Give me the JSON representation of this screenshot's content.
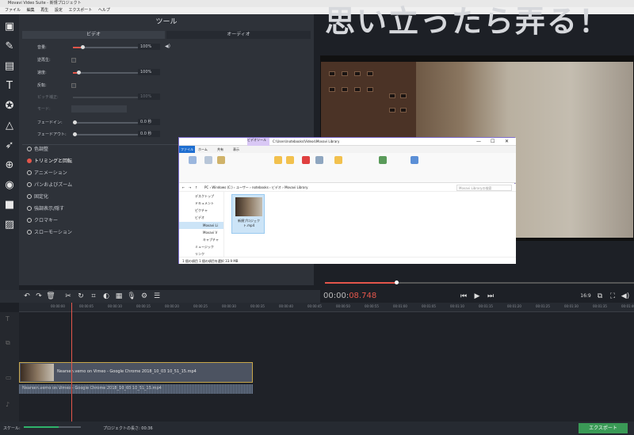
{
  "window": {
    "title": "Movavi Video Suite - 新規プロジェクト"
  },
  "menu": [
    "ファイル",
    "編集",
    "再生",
    "設定",
    "エクスポート",
    "ヘルプ"
  ],
  "logo_text": "思い立ったら弄る！",
  "panel": {
    "title": "ツール",
    "tabs": [
      "ビデオ",
      "オーディオ"
    ],
    "controls": [
      {
        "label": "音量:",
        "value": "100%",
        "level": 0.1
      },
      {
        "label": "逆再生:"
      },
      {
        "label": "速度:",
        "value": "100%",
        "level": 0.05
      },
      {
        "label": "反転:"
      },
      {
        "label": "ピッチ補正:",
        "value": "100%"
      },
      {
        "label": "モード:"
      },
      {
        "label": "フェードイン:",
        "value": "0.0 秒"
      },
      {
        "label": "フェードアウト:",
        "value": "0.0 秒"
      }
    ],
    "effects": [
      "色調整",
      "トリミングと回転",
      "アニメーション",
      "パンおよびズーム",
      "固定化",
      "強調表示/隠す",
      "クロマキー",
      "スローモーション"
    ]
  },
  "player": {
    "timecode_main": "00:00:",
    "timecode_ms": "08.748",
    "progress": 0.23,
    "aspect": "16:9"
  },
  "ruler_ticks": [
    "00:00:00",
    "00:00:05",
    "00:00:10",
    "00:00:15",
    "00:00:20",
    "00:00:25",
    "00:00:30",
    "00:00:35",
    "00:00:40",
    "00:00:45",
    "00:00:50",
    "00:00:55",
    "00:01:00",
    "00:01:05",
    "00:01:10",
    "00:01:15",
    "00:01:20",
    "00:01:25",
    "00:01:30",
    "00:01:35",
    "00:01:40",
    "00:01:45"
  ],
  "clip": {
    "label": "Nearsen.vemo on Vimeo - Google Chrome 2018_10_03 10_51_15.mp4"
  },
  "audio": {
    "label": "Nearsen.vemo on Vimeo - Google Chrome 2018_10_03 10_51_15.mp4"
  },
  "status": {
    "scale_label": "スケール:",
    "project_length": "プロジェクトの長さ: 00:36",
    "export_label": "エクスポート"
  },
  "explorer": {
    "title": "C:\\Users\\notebooks\\Videos\\Movavi Library",
    "ribbon_tabs": [
      "ファイル",
      "ホーム",
      "共有",
      "表示",
      "ビデオツール"
    ],
    "address": "PC › Windows (C:) › ユーザー › notebooks › ビデオ › Movavi Library",
    "search_placeholder": "Movavi Libraryの検索",
    "nav_items": [
      "デスクトップ",
      "ドキュメント",
      "ピクチャ",
      "ビデオ",
      "Movavi Li",
      "Movavi V",
      "キャプチャ",
      "ミュージック",
      "リンク"
    ],
    "file_name": "新規プロジェクト.mp4",
    "status_left": "1 個の項目  1 個の項目を選択 33.9 MB"
  }
}
